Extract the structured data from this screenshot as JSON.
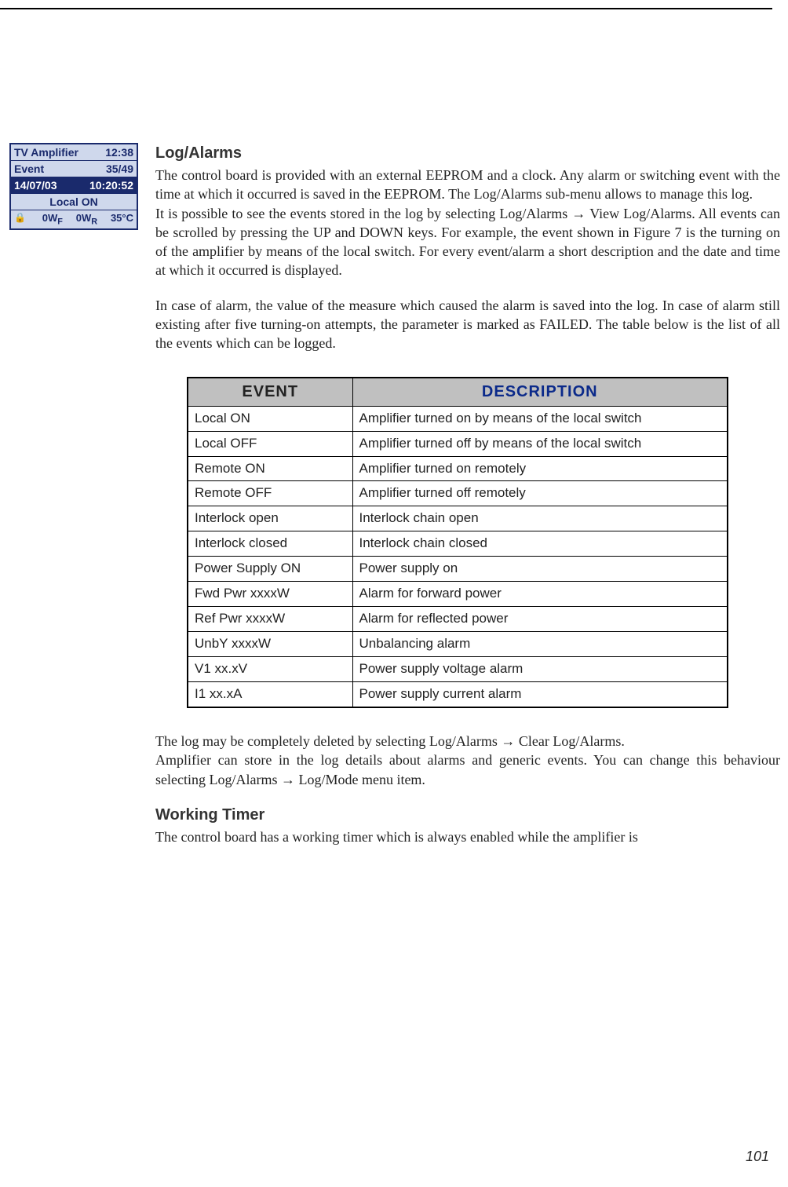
{
  "page_number": "101",
  "lcd": {
    "title": "TV  Amplifier",
    "clock": "12:38",
    "event_label": "Event",
    "event_count": "35/49",
    "date": "14/07/03",
    "time": "10:20:52",
    "status": "Local  ON",
    "lock_icon": "lock-icon",
    "fwd": "0W",
    "fwd_sub": "F",
    "ref": "0W",
    "ref_sub": "R",
    "temp": "35°C"
  },
  "sections": {
    "log_alarms": {
      "title": "Log/Alarms",
      "p1": "The control board is provided with an external EEPROM and a clock. Any alarm or switching event with the time at which it occurred is saved in the EEPROM. The Log/Alarms sub-menu allows to manage this log.",
      "p2": "It is possible to see the events stored in the log by selecting Log/Alarms → View Log/Alarms. All events can be scrolled by pressing the UP and DOWN keys. For example, the event shown in Figure 7 is the turning on of the amplifier by means of the local switch. For every event/alarm a short description and the date and time at which it occurred is displayed.",
      "p3": "In case of alarm, the value of the measure which caused the alarm is saved into the log. In case of alarm still existing after five turning-on attempts, the parameter is marked as FAILED. The table below is the list of all the events which can be logged.",
      "p4": "The log may be completely deleted by selecting Log/Alarms → Clear Log/Alarms.",
      "p5": "Amplifier can store in the log details about alarms and generic events. You can change this behaviour selecting Log/Alarms → Log/Mode menu item."
    },
    "working_timer": {
      "title": "Working Timer",
      "p1": "The control board has a working timer which is always enabled while the amplifier is"
    }
  },
  "table": {
    "headers": {
      "event": "EVENT",
      "description": "DESCRIPTION"
    },
    "rows": [
      {
        "event": "Local ON",
        "description": "Amplifier turned on by means of the local switch"
      },
      {
        "event": "Local OFF",
        "description": "Amplifier turned off by means of the local switch"
      },
      {
        "event": "Remote ON",
        "description": "Amplifier turned on remotely"
      },
      {
        "event": "Remote OFF",
        "description": "Amplifier turned off remotely"
      },
      {
        "event": "Interlock open",
        "description": "Interlock chain open"
      },
      {
        "event": "Interlock closed",
        "description": "Interlock chain closed"
      },
      {
        "event": "Power Supply ON",
        "description": "Power supply on"
      },
      {
        "event": "Fwd Pwr xxxxW",
        "description": "Alarm for forward power"
      },
      {
        "event": "Ref Pwr xxxxW",
        "description": "Alarm for reflected power"
      },
      {
        "event": "UnbY xxxxW",
        "description": "Unbalancing alarm"
      },
      {
        "event": "V1 xx.xV",
        "description": "Power supply voltage alarm"
      },
      {
        "event": "I1 xx.xA",
        "description": "Power supply current alarm"
      }
    ]
  }
}
